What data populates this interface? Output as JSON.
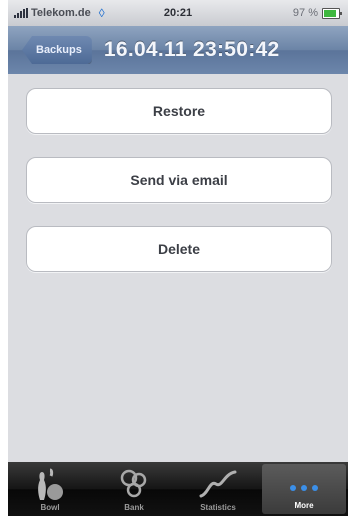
{
  "status_bar": {
    "carrier": "Telekom.de",
    "time": "20:21",
    "battery": "97 %"
  },
  "nav": {
    "back_label": "Backups",
    "title": "16.04.11 23:50:42"
  },
  "actions": [
    {
      "label": "Restore"
    },
    {
      "label": "Send via email"
    },
    {
      "label": "Delete"
    }
  ],
  "tabs": [
    {
      "label": "Bowl",
      "icon": "bowling-pins-icon"
    },
    {
      "label": "Bank",
      "icon": "bowling-balls-icon"
    },
    {
      "label": "Statistics",
      "icon": "statistics-curve-icon"
    },
    {
      "label": "More",
      "icon": "more-dots-icon",
      "selected": true
    }
  ],
  "colors": {
    "nav_bar": "#6c86ab",
    "background": "#dcdde1",
    "tab_bar": "#111111",
    "more_dots": "#3b8fe8"
  }
}
